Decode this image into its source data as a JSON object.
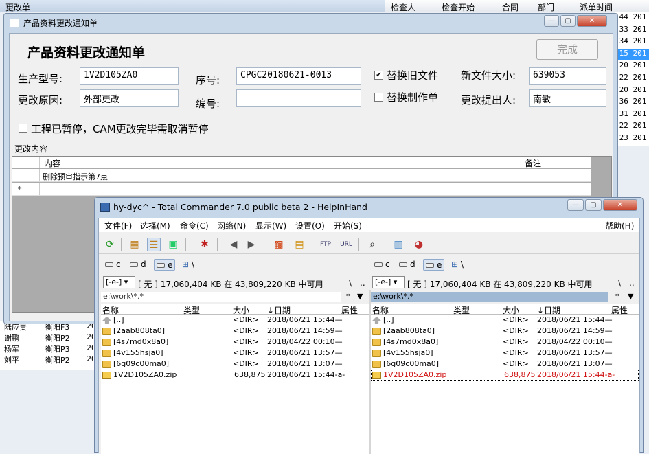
{
  "background_app": {
    "title": "更改单",
    "headers": [
      "检查人",
      "检查开始",
      "合同",
      "部门",
      "派单时间"
    ],
    "right_rows": [
      {
        "text": ":44 201",
        "selected": false
      },
      {
        "text": ":33 201",
        "selected": false
      },
      {
        "text": ":34 201",
        "selected": false
      },
      {
        "text": ":15 201",
        "selected": true
      },
      {
        "text": ":20 201",
        "selected": false
      },
      {
        "text": ":22 201",
        "selected": false
      },
      {
        "text": ":20 201",
        "selected": false
      },
      {
        "text": ":36 201",
        "selected": false
      },
      {
        "text": ":31 201",
        "selected": false
      },
      {
        "text": ":22 201",
        "selected": false
      },
      {
        "text": ":23 201",
        "selected": false
      }
    ],
    "left_rows": [
      {
        "name": "陆应责",
        "dept": "衡阳F3",
        "num": "20"
      },
      {
        "name": "谢鹏",
        "dept": "衡阳P2",
        "num": "20"
      },
      {
        "name": "杨军",
        "dept": "衡阳P3",
        "num": "20"
      },
      {
        "name": "刘平",
        "dept": "衡阳P2",
        "num": "20"
      }
    ]
  },
  "dialog": {
    "window_title": "产品资料更改通知单",
    "heading": "产品资料更改通知单",
    "done_button": "完成",
    "fields": {
      "model_label": "生产型号:",
      "model_value": "1V2D105ZA0",
      "serial_label": "序号:",
      "serial_value": "CPGC20180621-0013",
      "replace_old_label": "替换旧文件",
      "replace_old_checked": true,
      "new_size_label": "新文件大小:",
      "new_size_value": "639053",
      "reason_label": "更改原因:",
      "reason_value": "外部更改",
      "code_label": "编号:",
      "code_value": "",
      "replace_sheet_label": "替换制作单",
      "replace_sheet_checked": false,
      "proposer_label": "更改提出人:",
      "proposer_value": "南敏",
      "pause_label": "工程已暂停，CAM更改完毕需取消暂停",
      "pause_checked": false
    },
    "content_section_label": "更改内容",
    "grid": {
      "headers": [
        "内容",
        "备注"
      ],
      "rows": [
        {
          "marker": "",
          "content": "删除预审指示第7点",
          "note": ""
        },
        {
          "marker": "*",
          "content": "",
          "note": ""
        }
      ]
    }
  },
  "total_commander": {
    "title": "hy-dyc^ - Total Commander 7.0 public beta 2 - HelpInHand",
    "menu": [
      "文件(F)",
      "选择(M)",
      "命令(C)",
      "网络(N)",
      "显示(W)",
      "设置(O)",
      "开始(S)"
    ],
    "help_menu": "帮助(H)",
    "drives": [
      "c",
      "d",
      "e"
    ],
    "active_drive": "e",
    "root_label": "\\",
    "drive_select": "[-e-]",
    "free_space": "[ 无 ]  17,060,404 KB 在 43,809,220 KB 中可用",
    "nav_back": "\\",
    "nav_up": "..",
    "path": "e:\\work\\*.*",
    "filter": "*",
    "columns": {
      "name": "名称",
      "type": "类型",
      "size": "大小",
      "date": "↓日期",
      "attr": "属性"
    },
    "files": [
      {
        "name": "[..]",
        "icon": "up-icon",
        "size": "<DIR>",
        "date": "2018/06/21 15:44—"
      },
      {
        "name": "[2aab808ta0]",
        "icon": "folder-icon",
        "size": "<DIR>",
        "date": "2018/06/21 14:59—"
      },
      {
        "name": "[4s7md0x8a0]",
        "icon": "folder-icon",
        "size": "<DIR>",
        "date": "2018/04/22 00:10—"
      },
      {
        "name": "[4v155hsja0]",
        "icon": "folder-icon",
        "size": "<DIR>",
        "date": "2018/06/21 13:57—"
      },
      {
        "name": "[6g09c00ma0]",
        "icon": "folder-icon",
        "size": "<DIR>",
        "date": "2018/06/21 13:07—"
      },
      {
        "name": "1V2D105ZA0.zip",
        "icon": "zip-icon",
        "size": "638,875",
        "date": "2018/06/21 15:44-a-"
      }
    ],
    "right_selected_file": "1V2D105ZA0.zip",
    "colors": {
      "selected_text": "#d01010",
      "path_bar": "#9fb8d3"
    }
  }
}
